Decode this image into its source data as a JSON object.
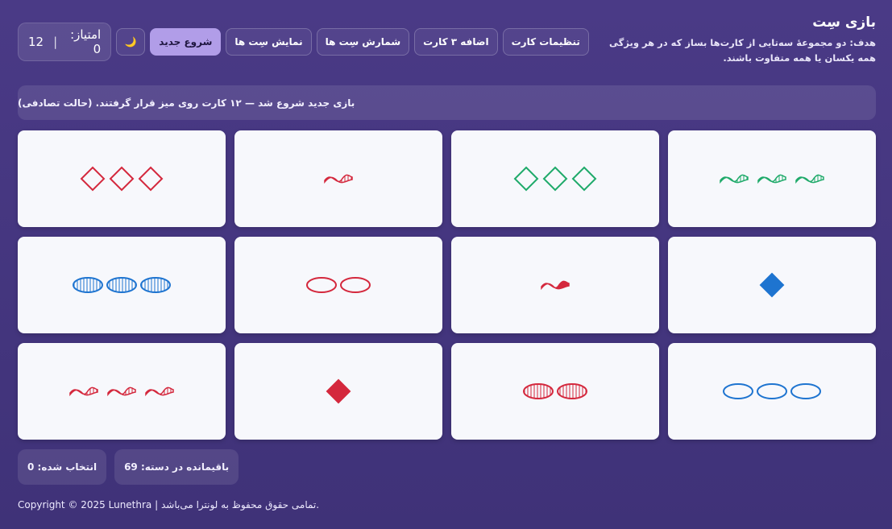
{
  "header": {
    "title": "بازی سِت",
    "subtitle": "هدف: دو مجموعهٔ سه‌تایی از کارت‌ها بساز که در هر ویژگی همه یکسان یا همه متفاوت باشند."
  },
  "scoreboard": {
    "score_label": "امتیاز: 0",
    "separator": "|",
    "count": "12"
  },
  "toolbar": {
    "settings": "تنظیمات کارت",
    "add_three": "اضافه ۳ کارت",
    "count_sets": "شمارش سِت ها",
    "show_sets": "نمایش سِت ها",
    "new_game": "شروع جدید",
    "theme_icon": "moon-icon",
    "theme_glyph": "🌙"
  },
  "status": {
    "message": "بازی جدید شروع شد — ۱۲ کارت روی میز قرار گرفتند. (حالت تصادفی)"
  },
  "colors": {
    "red": "#d4283d",
    "green": "#1faa6a",
    "blue": "#1e74d0"
  },
  "cards": [
    {
      "count": 3,
      "shape": "squiggle",
      "color": "green",
      "fill": "striped"
    },
    {
      "count": 3,
      "shape": "diamond",
      "color": "green",
      "fill": "empty"
    },
    {
      "count": 1,
      "shape": "squiggle",
      "color": "red",
      "fill": "striped"
    },
    {
      "count": 3,
      "shape": "diamond",
      "color": "red",
      "fill": "empty"
    },
    {
      "count": 1,
      "shape": "diamond",
      "color": "blue",
      "fill": "solid"
    },
    {
      "count": 1,
      "shape": "squiggle",
      "color": "red",
      "fill": "solid"
    },
    {
      "count": 2,
      "shape": "oval",
      "color": "red",
      "fill": "empty"
    },
    {
      "count": 3,
      "shape": "oval",
      "color": "blue",
      "fill": "striped"
    },
    {
      "count": 3,
      "shape": "oval",
      "color": "blue",
      "fill": "empty"
    },
    {
      "count": 2,
      "shape": "oval",
      "color": "red",
      "fill": "striped"
    },
    {
      "count": 1,
      "shape": "diamond",
      "color": "red",
      "fill": "solid"
    },
    {
      "count": 3,
      "shape": "squiggle",
      "color": "red",
      "fill": "striped"
    }
  ],
  "stats": {
    "remaining": "باقیمانده در دسته: 69",
    "selected": "انتخاب شده: 0"
  },
  "footer": {
    "text": "Copyright © 2025 Lunethra | تمامی حقوق محفوظ به لونترا می‌باشد."
  }
}
